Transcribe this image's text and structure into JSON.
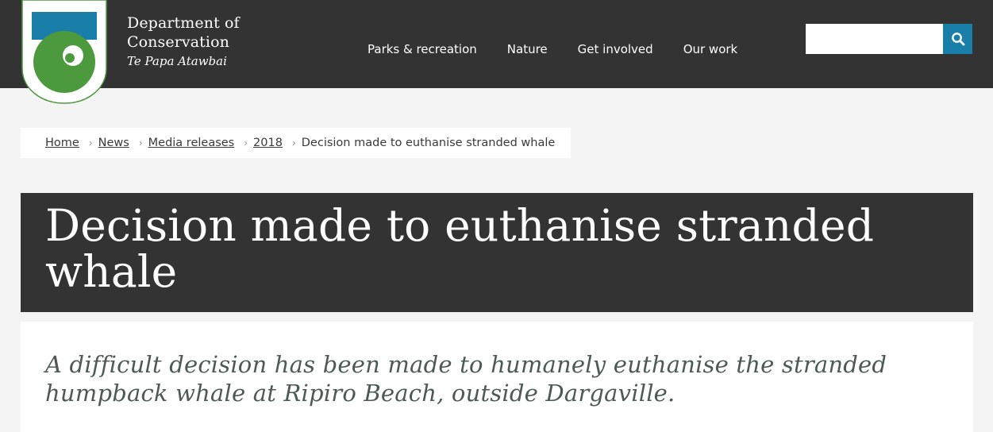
{
  "brand": {
    "line1": "Department of",
    "line2": "Conservation",
    "line3": "Te Papa Atawbai"
  },
  "nav": {
    "items": [
      "Parks & recreation",
      "Nature",
      "Get involved",
      "Our work"
    ]
  },
  "search": {
    "placeholder": "",
    "value": "",
    "icon": "search-icon"
  },
  "breadcrumb": {
    "items": [
      "Home",
      "News",
      "Media releases",
      "2018"
    ],
    "current": "Decision made to euthanise stranded whale"
  },
  "page": {
    "title": "Decision made to euthanise stranded whale",
    "intro": "A difficult decision has been made to humanely euthanise the stranded humpback whale at Ripiro Beach, outside Dargaville."
  },
  "colors": {
    "header_bg": "#333333",
    "search_button": "#1a7fa8",
    "logo_blue": "#1a7fa8",
    "logo_green": "#4d9a3e"
  }
}
